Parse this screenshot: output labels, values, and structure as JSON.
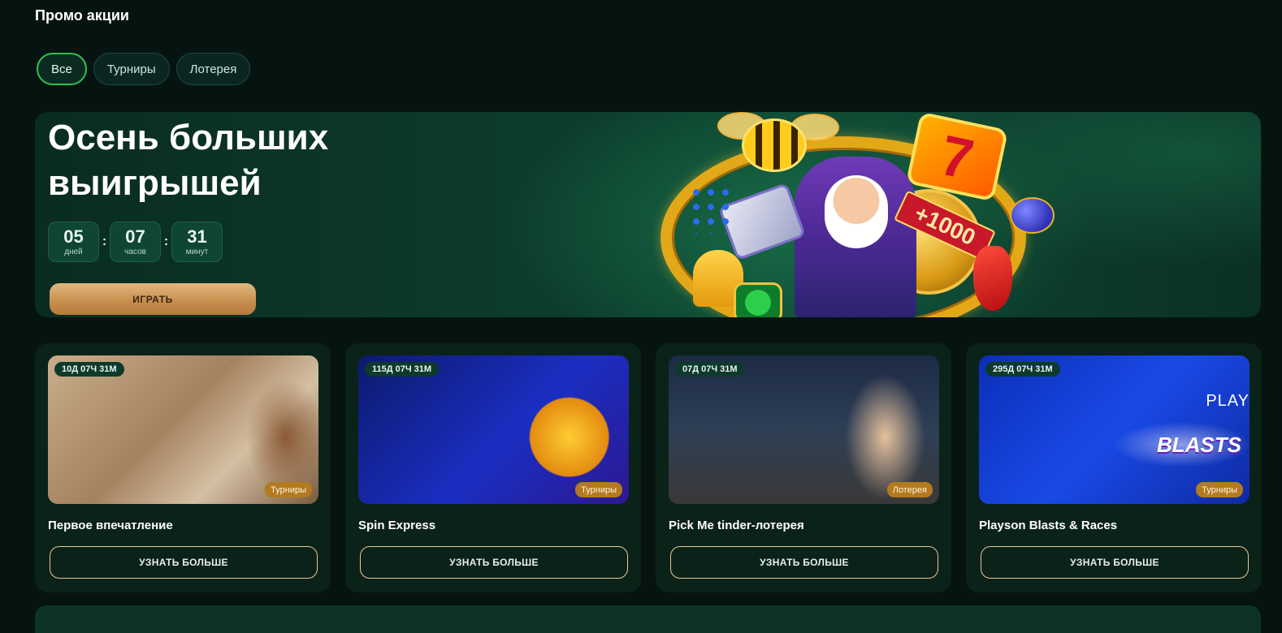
{
  "page": {
    "title": "Промо акции"
  },
  "filters": [
    {
      "label": "Все",
      "active": true
    },
    {
      "label": "Турниры",
      "active": false
    },
    {
      "label": "Лотерея",
      "active": false
    }
  ],
  "hero": {
    "title": "Осень больших выигрышей",
    "countdown": [
      {
        "value": "05",
        "label": "дней"
      },
      {
        "value": "07",
        "label": "часов"
      },
      {
        "value": "31",
        "label": "минут"
      }
    ],
    "separator": ":",
    "play_label": "ИГРАТЬ",
    "art_banner": "+1000",
    "art_seven": "7"
  },
  "promos": [
    {
      "time_left": "10Д 07Ч 31М",
      "type": "Турниры",
      "title": "Первое впечатление",
      "button": "УЗНАТЬ БОЛЬШЕ"
    },
    {
      "time_left": "115Д 07Ч 31М",
      "type": "Турниры",
      "title": "Spin Express",
      "button": "УЗНАТЬ БОЛЬШЕ"
    },
    {
      "time_left": "07Д 07Ч 31М",
      "type": "Лотерея",
      "title": "Pick Me tinder-лотерея",
      "button": "УЗНАТЬ БОЛЬШЕ"
    },
    {
      "time_left": "295Д 07Ч 31М",
      "type": "Турниры",
      "title": "Playson Blasts & Races",
      "button": "УЗНАТЬ БОЛЬШЕ",
      "image_text": "BLASTS",
      "image_brand": "PLAY"
    }
  ],
  "colors": {
    "background": "#061411",
    "active_chip_border": "#2ec24d",
    "play_button": "#c8904f",
    "type_badge": "#b37a1e"
  }
}
